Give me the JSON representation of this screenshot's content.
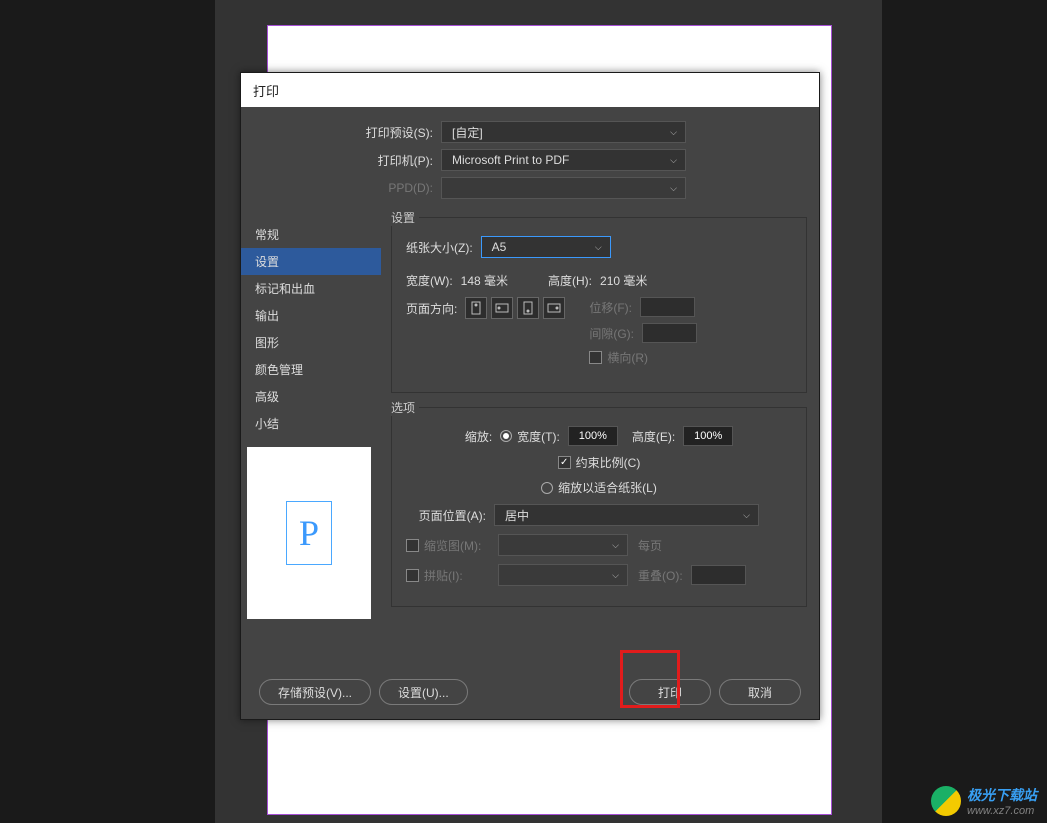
{
  "dialog": {
    "title": "打印"
  },
  "top": {
    "preset_label": "打印预设(S):",
    "preset_value": "[自定]",
    "printer_label": "打印机(P):",
    "printer_value": "Microsoft Print to PDF",
    "ppd_label": "PPD(D):"
  },
  "sidebar": {
    "items": [
      "常规",
      "设置",
      "标记和出血",
      "输出",
      "图形",
      "颜色管理",
      "高级",
      "小结"
    ],
    "selected": 1
  },
  "settings": {
    "group_title": "设置",
    "paper_size_label": "纸张大小(Z):",
    "paper_size_value": "A5",
    "width_label": "宽度(W):",
    "width_value": "148 毫米",
    "height_label": "高度(H):",
    "height_value": "210 毫米",
    "orientation_label": "页面方向:",
    "offset_label": "位移(F):",
    "gap_label": "间隙(G):",
    "landscape_label": "横向(R)"
  },
  "options": {
    "group_title": "选项",
    "scale_label": "缩放:",
    "width_pct_label": "宽度(T):",
    "width_pct_value": "100%",
    "height_pct_label": "高度(E):",
    "height_pct_value": "100%",
    "constrain_label": "约束比例(C)",
    "fit_label": "缩放以适合纸张(L)",
    "page_pos_label": "页面位置(A):",
    "page_pos_value": "居中",
    "thumb_label": "缩览图(M):",
    "every_page": "每页",
    "tile_label": "拼贴(I):",
    "overlap_label": "重叠(O):"
  },
  "footer": {
    "save_preset": "存储预设(V)...",
    "setup": "设置(U)...",
    "print": "打印",
    "cancel": "取消"
  },
  "watermark": {
    "name": "极光下载站",
    "url": "www.xz7.com"
  }
}
